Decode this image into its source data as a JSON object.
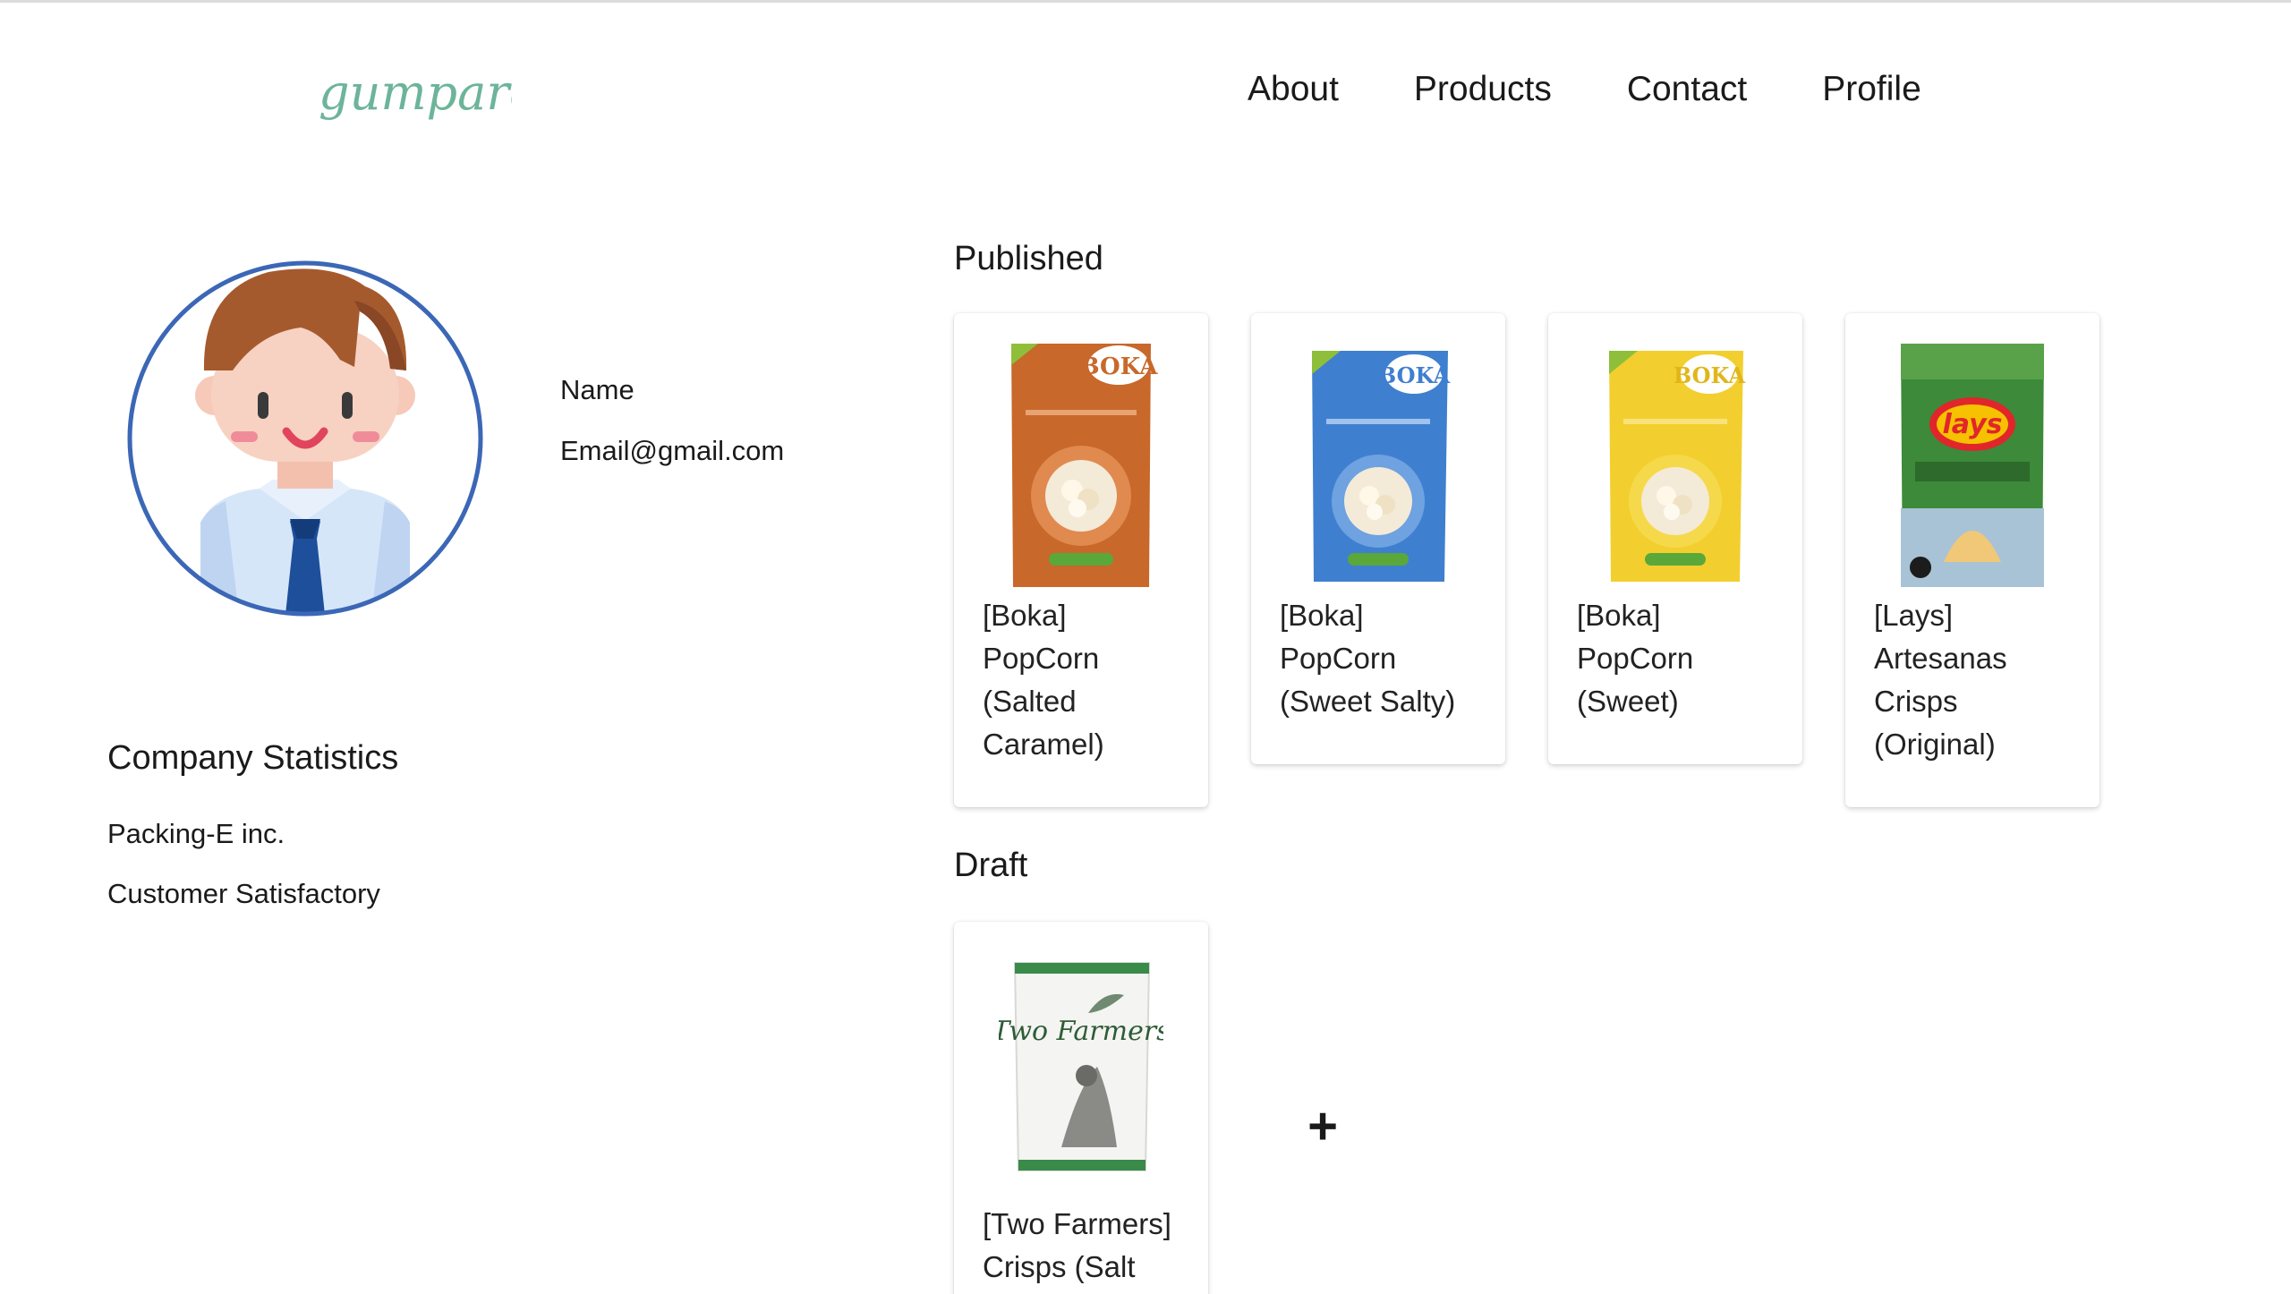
{
  "header": {
    "logo_text": "gumpare",
    "nav": [
      "About",
      "Products",
      "Contact",
      "Profile"
    ]
  },
  "profile": {
    "name": "Name",
    "email": "Email@gmail.com"
  },
  "company_statistics": {
    "title": "Company Statistics",
    "company": "Packing-E inc.",
    "satisfaction": "Customer Satisfactory"
  },
  "published": {
    "title": "Published",
    "items": [
      {
        "lines": [
          "[Boka]",
          "PopCorn",
          "(Salted",
          "Caramel)"
        ],
        "color": "#c8682a",
        "brand": "BOKA",
        "icon": "popcorn-bag-icon"
      },
      {
        "lines": [
          "[Boka]",
          "PopCorn",
          "(Sweet Salty)"
        ],
        "color": "#3f7fd0",
        "brand": "BOKA",
        "icon": "popcorn-bag-icon"
      },
      {
        "lines": [
          "[Boka]",
          "PopCorn",
          "(Sweet)"
        ],
        "color": "#f2cf2e",
        "brand": "BOKA",
        "icon": "popcorn-bag-icon"
      },
      {
        "lines": [
          "[Lays]",
          "Artesanas",
          "Crisps",
          "(Original)"
        ],
        "color": "#3c8a3a",
        "brand": "lays",
        "icon": "chips-bag-icon"
      }
    ]
  },
  "draft": {
    "title": "Draft",
    "items": [
      {
        "lines": [
          "[Two Farmers]",
          "Crisps (Salt"
        ],
        "color": "#3a8a4a",
        "brand": "Two Farmers",
        "icon": "chips-bag-icon"
      }
    ],
    "add_label": "+"
  }
}
